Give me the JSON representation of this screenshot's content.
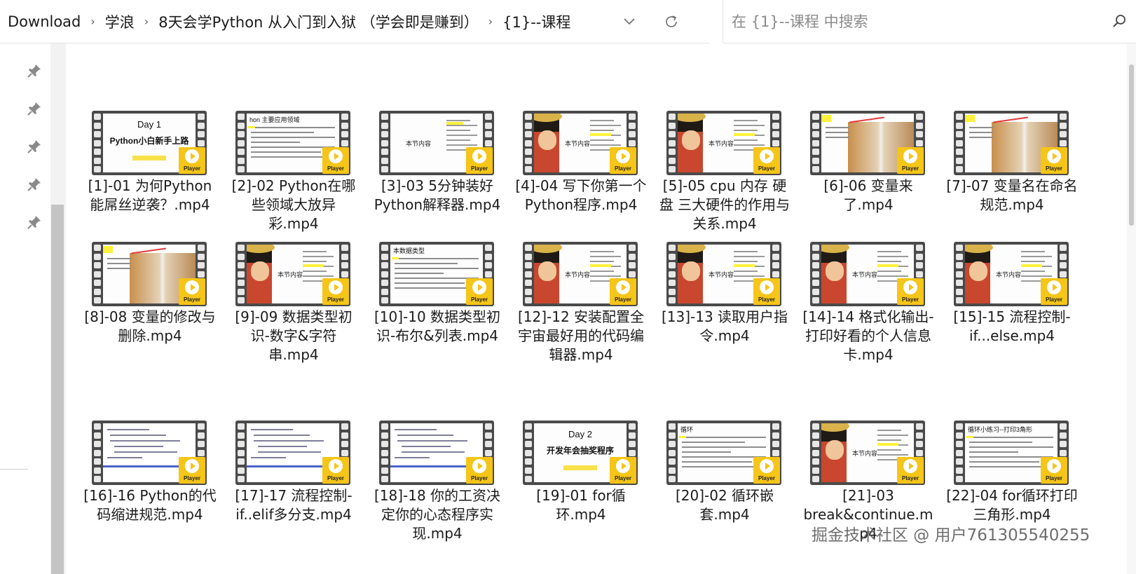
{
  "breadcrumb": [
    "Download",
    "学浪",
    "8天会学Python 从入门到入狱 （学会即是赚到）",
    "{1}--课程"
  ],
  "search": {
    "placeholder": "在 {1}--课程 中搜索"
  },
  "badge_label": "Player",
  "files": [
    {
      "name": "[1]-01 为何Python能屌丝逆袭？.mp4",
      "thumb": "title",
      "title": "Day 1",
      "subtitle": "Python小白新手上路"
    },
    {
      "name": "[2]-02 Python在哪些领域大放异彩.mp4",
      "thumb": "doc",
      "title": "hon 主要应用领域"
    },
    {
      "name": "[3]-03 5分钟装好Python解释器.mp4",
      "thumb": "outline",
      "label": "本节内容"
    },
    {
      "name": "[4]-04 写下你第一个Python程序.mp4",
      "thumb": "luffy",
      "label": "本节内容"
    },
    {
      "name": "[5]-05 cpu 内存 硬盘 三大硬件的作用与关系.mp4",
      "thumb": "luffy",
      "label": "本节内容"
    },
    {
      "name": "[6]-06 变量来了.mp4",
      "thumb": "warehouse"
    },
    {
      "name": "[7]-07 变量名在命名规范.mp4",
      "thumb": "warehouse"
    },
    {
      "name": "[8]-08 变量的修改与删除.mp4",
      "thumb": "warehouse"
    },
    {
      "name": "[9]-09 数据类型初识-数字&字符串.mp4",
      "thumb": "luffy",
      "label": "本节内容"
    },
    {
      "name": "[10]-10 数据类型初识-布尔&列表.mp4",
      "thumb": "doc",
      "title": "本数据类型"
    },
    {
      "name": "[12]-12 安装配置全宇宙最好用的代码编辑器.mp4",
      "thumb": "luffy",
      "label": "本节内容"
    },
    {
      "name": "[13]-13 读取用户指令.mp4",
      "thumb": "luffy",
      "label": "本节内容"
    },
    {
      "name": "[14]-14 格式化输出-打印好看的个人信息卡.mp4",
      "thumb": "luffy",
      "label": "本节内容"
    },
    {
      "name": "[15]-15 流程控制-if...else.mp4",
      "thumb": "luffy",
      "label": "本节内容"
    },
    {
      "name": "[16]-16 Python的代码缩进规范.mp4",
      "thumb": "code"
    },
    {
      "name": "[17]-17 流程控制-if..elif多分支.mp4",
      "thumb": "code"
    },
    {
      "name": "[18]-18 你的工资决定你的心态程序实现.mp4",
      "thumb": "code"
    },
    {
      "name": "[19]-01 for循环.mp4",
      "thumb": "title",
      "title": "Day 2",
      "subtitle": "开发年会抽奖程序"
    },
    {
      "name": "[20]-02 循环嵌套.mp4",
      "thumb": "doc",
      "title": "循环"
    },
    {
      "name": "[21]-03 break&continue.mp4",
      "thumb": "luffy",
      "label": "本节内容"
    },
    {
      "name": "[22]-04 for循环打印三角形.mp4",
      "thumb": "doc",
      "title": "循环小练习--打印3角形"
    }
  ],
  "watermark": "掘金技术社区 @ 用户761305540255",
  "icons": [
    "chevron-right-icon",
    "chevron-down-icon",
    "refresh-icon",
    "search-icon",
    "pin-icon",
    "play-icon"
  ]
}
